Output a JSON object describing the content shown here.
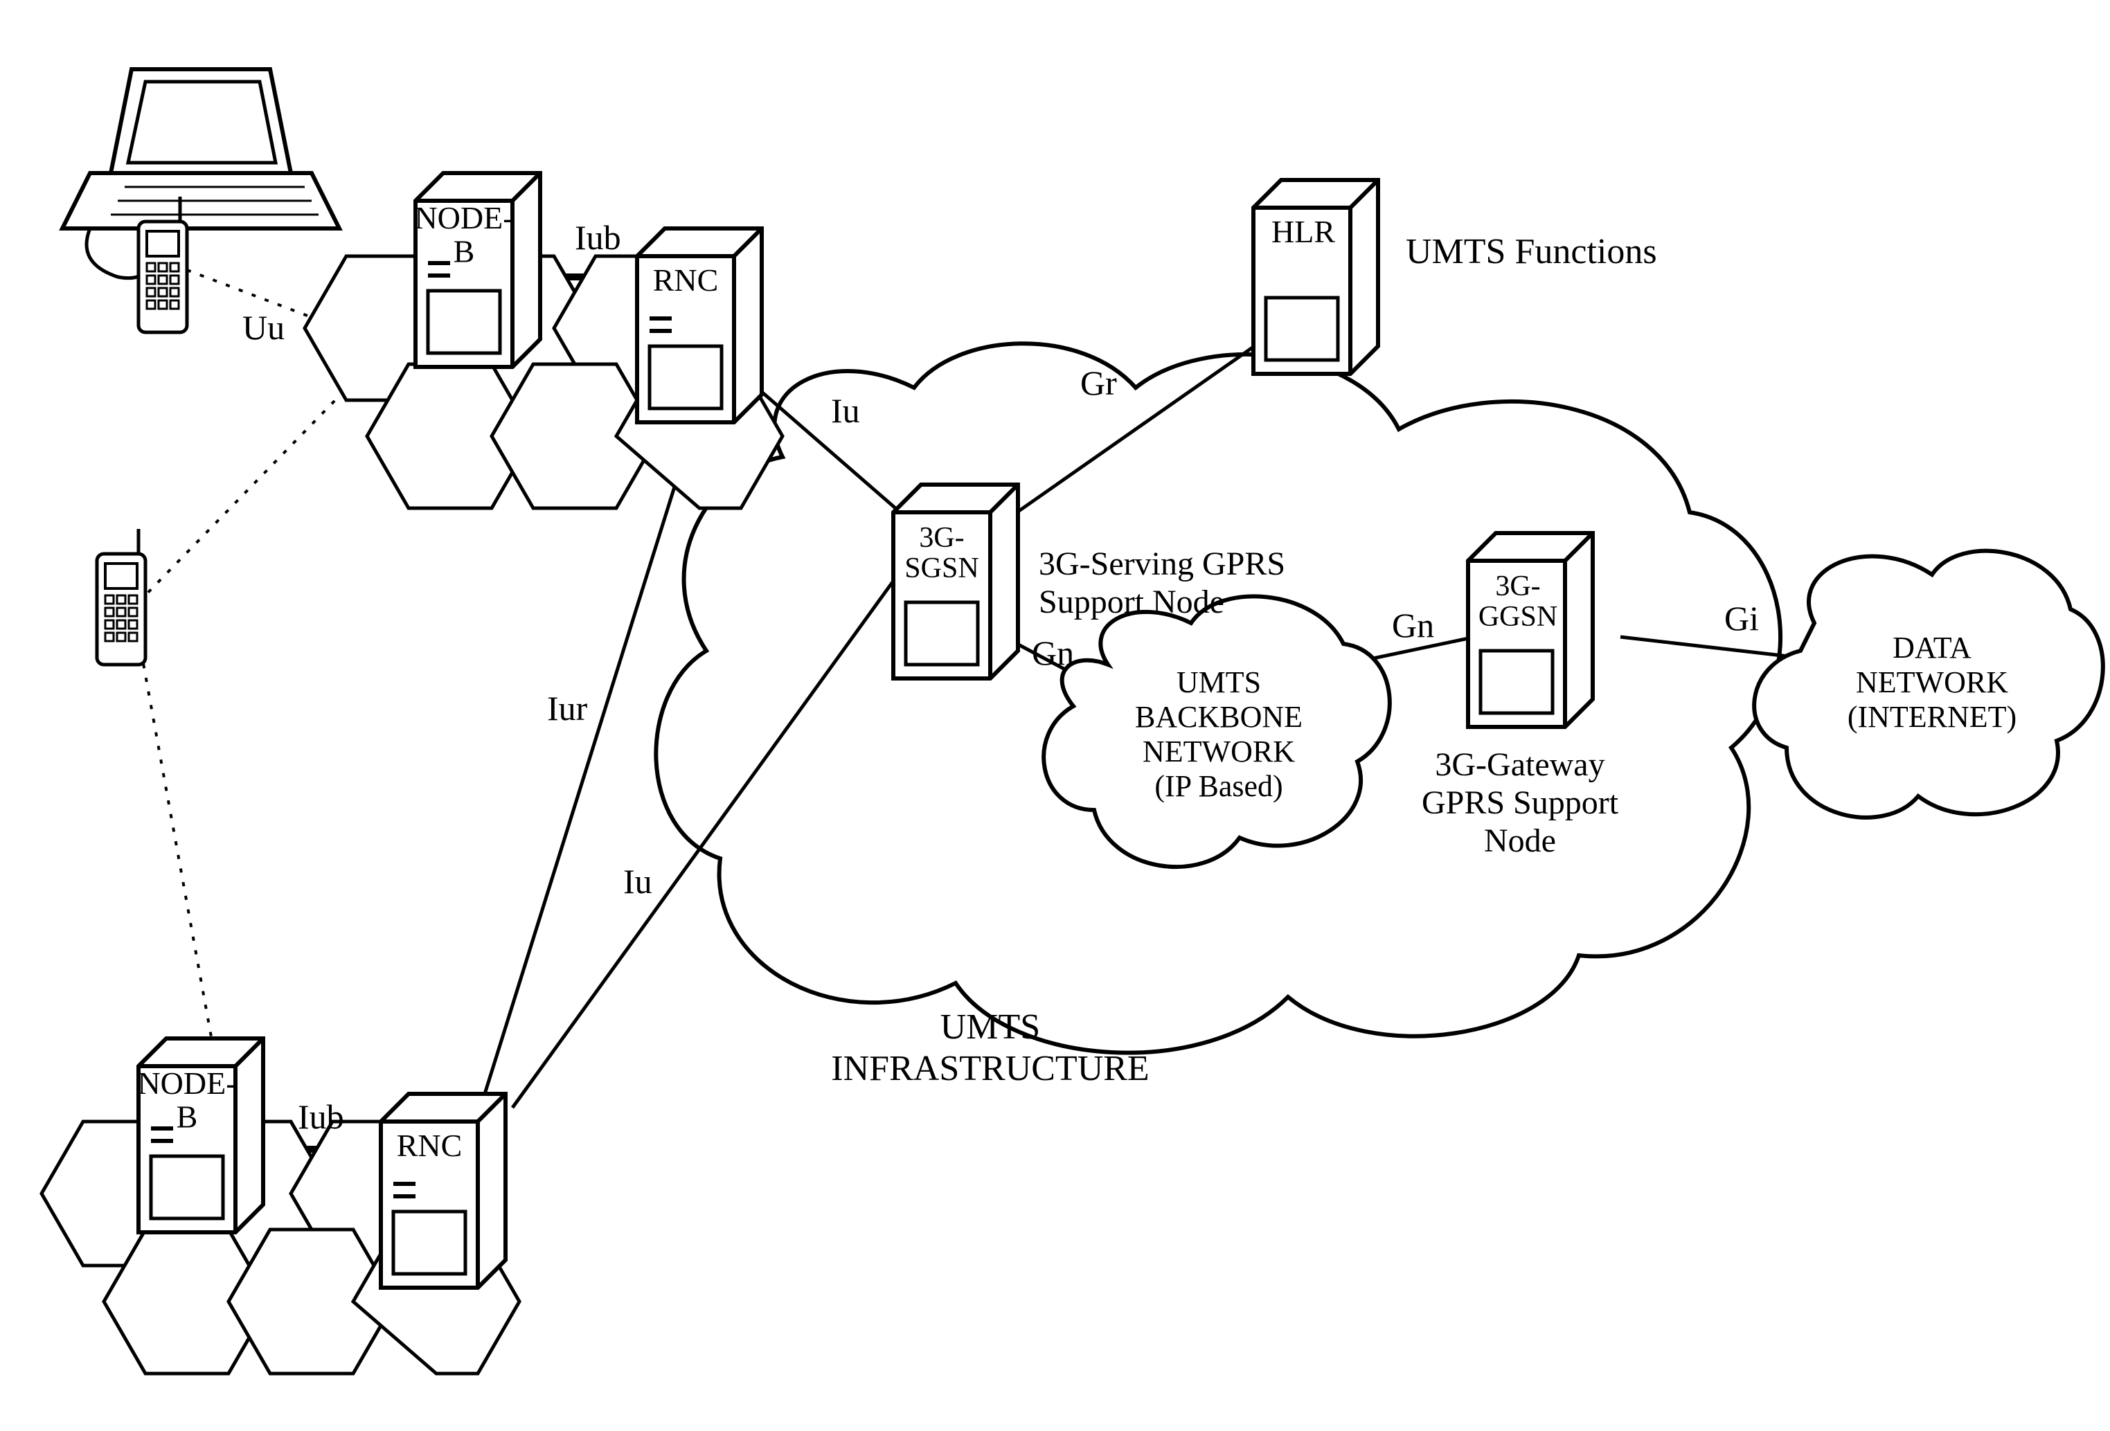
{
  "nodes": {
    "nodeb1": "NODE-\nB",
    "rnc1": "RNC",
    "nodeb2": "NODE-\nB",
    "rnc2": "RNC",
    "sgsn": "3G-\nSGSN",
    "hlr": "HLR",
    "ggsn": "3G-\nGGSN"
  },
  "clouds": {
    "backbone_l1": "UMTS",
    "backbone_l2": "BACKBONE",
    "backbone_l3": "NETWORK",
    "backbone_l4": "(IP Based)",
    "internet_l1": "DATA",
    "internet_l2": "NETWORK",
    "internet_l3": "(INTERNET)"
  },
  "edges": {
    "uu": "Uu",
    "iub1": "Iub",
    "iub2": "Iub",
    "iur": "Iur",
    "iu1": "Iu",
    "iu2": "Iu",
    "gr": "Gr",
    "gn1": "Gn",
    "gn2": "Gn",
    "gi": "Gi"
  },
  "captions": {
    "sgsn_desc_l1": "3G-Serving GPRS",
    "sgsn_desc_l2": "Support Node",
    "ggsn_desc_l1": "3G-Gateway",
    "ggsn_desc_l2": "GPRS Support",
    "ggsn_desc_l3": "Node",
    "umts_funcs": "UMTS Functions",
    "infra_l1": "UMTS",
    "infra_l2": "INFRASTRUCTURE"
  }
}
